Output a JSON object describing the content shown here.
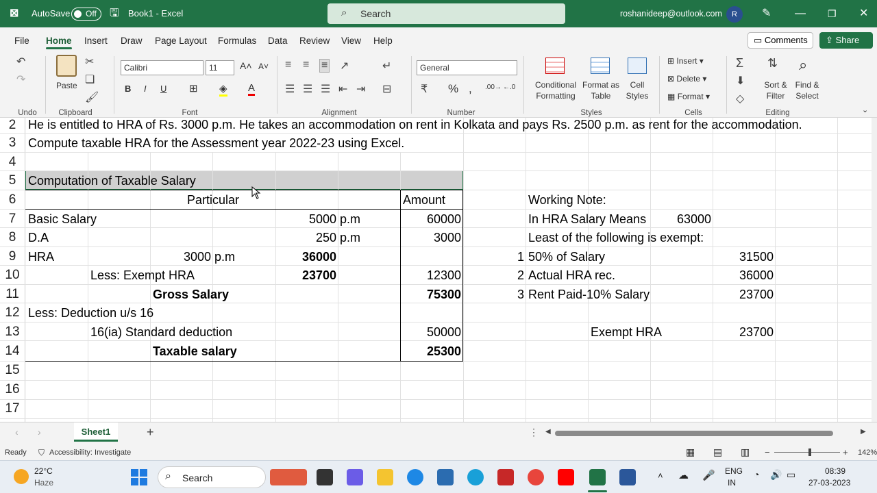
{
  "titlebar": {
    "autosave_label": "AutoSave",
    "autosave_state": "Off",
    "book_title": "Book1 - Excel",
    "search_placeholder": "Search",
    "account": "roshanideep@outlook.com",
    "avatar_initial": "R"
  },
  "menu": [
    "File",
    "Home",
    "Insert",
    "Draw",
    "Page Layout",
    "Formulas",
    "Data",
    "Review",
    "View",
    "Help"
  ],
  "menu_active": "Home",
  "comments_label": "Comments",
  "share_label": "Share",
  "ribbon": {
    "undo_group": "Undo",
    "paste_label": "Paste",
    "clipboard_group": "Clipboard",
    "font_name": "Calibri",
    "font_size": "11",
    "font_group": "Font",
    "alignment_group": "Alignment",
    "number_format": "General",
    "number_group": "Number",
    "conditional_formatting": [
      "Conditional",
      "Formatting"
    ],
    "format_as_table": [
      "Format as",
      "Table"
    ],
    "cell_styles": [
      "Cell",
      "Styles"
    ],
    "styles_group": "Styles",
    "insert_label": "Insert",
    "delete_label": "Delete",
    "format_label": "Format",
    "cells_group": "Cells",
    "sort_filter": [
      "Sort &",
      "Filter"
    ],
    "find_select": [
      "Find &",
      "Select"
    ],
    "editing_group": "Editing"
  },
  "sheet": {
    "row_numbers": [
      "2",
      "3",
      "4",
      "5",
      "6",
      "7",
      "8",
      "9",
      "10",
      "11",
      "12",
      "13",
      "14",
      "15",
      "16",
      "17"
    ],
    "row2": "He is entitled to HRA of Rs. 3000 p.m. He takes an accommodation on rent in Kolkata and pays Rs. 2500 p.m. as rent for the accommodation.",
    "row3": " Compute taxable HRA for the Assessment year 2022-23 using Excel.",
    "title": "Computation of Taxable Salary",
    "col_particular": "Particular",
    "col_amount": "Amount",
    "basic_label": "Basic Salary",
    "basic_pm": "5000",
    "basic_unit": "p.m",
    "basic_amount": "60000",
    "da_label": "D.A",
    "da_pm": "250",
    "da_unit": "p.m",
    "da_amount": "3000",
    "hra_label": "HRA",
    "hra_pm": "3000",
    "hra_unit": "p.m",
    "hra_annual": "36000",
    "exempt_label": "Less: Exempt HRA",
    "exempt_value": "23700",
    "exempt_amount": "12300",
    "gross_label": "Gross Salary",
    "gross_amount": "75300",
    "deduction_label": "Less: Deduction u/s 16",
    "std_label": "16(ia) Standard deduction",
    "std_amount": "50000",
    "taxable_label": "Taxable salary",
    "taxable_amount": "25300",
    "note_title": "Working Note:",
    "note_hra_label": "In HRA Salary Means",
    "note_hra_value": "63000",
    "note_least": "Least of the following is exempt:",
    "note_items": [
      {
        "n": "1",
        "label": "50% of Salary",
        "value": "31500"
      },
      {
        "n": "2",
        "label": "Actual HRA rec.",
        "value": "36000"
      },
      {
        "n": "3",
        "label": "Rent Paid-10% Salary",
        "value": "23700"
      }
    ],
    "exempt_hra_label": "Exempt HRA",
    "exempt_hra_value": "23700"
  },
  "sheet_tab": "Sheet1",
  "status": {
    "ready": "Ready",
    "accessibility": "Accessibility: Investigate",
    "zoom": "142%"
  },
  "taskbar": {
    "temperature": "22°C",
    "weather": "Haze",
    "search": "Search",
    "lang1": "ENG",
    "lang2": "IN",
    "time": "08:39",
    "date": "27-03-2023"
  },
  "colors": {
    "excel_green": "#217346",
    "selection": "#d0d0d0"
  }
}
